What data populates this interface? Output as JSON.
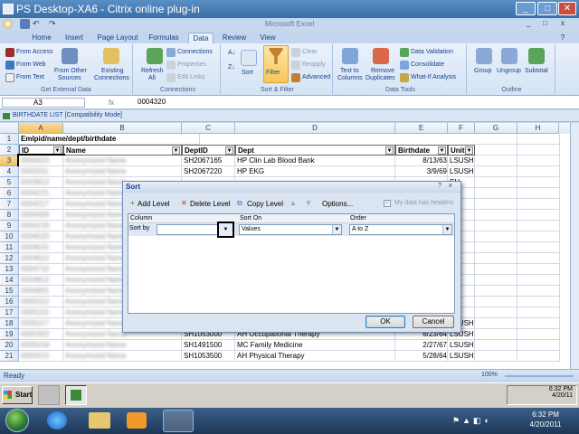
{
  "citrix": {
    "title": "PS Desktop-XA6 - Citrix online plug-in",
    "icon": "citrix-icon"
  },
  "excel": {
    "title": "Microsoft Excel"
  },
  "tabs": [
    "Home",
    "Insert",
    "Page Layout",
    "Formulas",
    "Data",
    "Review",
    "View"
  ],
  "active_tab": "Data",
  "ribbon": {
    "get_external_data": {
      "label": "Get External Data",
      "from_access": "From Access",
      "from_web": "From Web",
      "from_text": "From Text",
      "from_other": "From Other",
      "sources": "Sources",
      "existing": "Existing",
      "connections": "Connections"
    },
    "connections": {
      "label": "Connections",
      "refresh": "Refresh",
      "all": "All",
      "connections": "Connections",
      "properties": "Properties",
      "edit_links": "Edit Links"
    },
    "sort_filter": {
      "label": "Sort & Filter",
      "sort": "Sort",
      "filter": "Filter",
      "clear": "Clear",
      "reapply": "Reapply",
      "advanced": "Advanced"
    },
    "data_tools": {
      "label": "Data Tools",
      "text_to": "Text to",
      "columns": "Columns",
      "remove": "Remove",
      "duplicates": "Duplicates",
      "validation": "Data Validation",
      "consolidate": "Consolidate",
      "what_if": "What-If Analysis"
    },
    "outline": {
      "label": "Outline",
      "group": "Group",
      "ungroup": "Ungroup",
      "subtotal": "Subtotal"
    }
  },
  "formula": {
    "name_box": "A3",
    "fx": "fx",
    "value": "0004320"
  },
  "workbook": {
    "title": "BIRTHDATE LIST  [Compatibility Mode]"
  },
  "columns": [
    "A",
    "B",
    "C",
    "D",
    "E",
    "F",
    "G",
    "H"
  ],
  "rows": [
    {
      "n": "1",
      "a": "Emlpid/name/dept/birthdate",
      "b": "",
      "c": "",
      "d": "",
      "e": "",
      "f": ""
    },
    {
      "n": "2",
      "a": "ID",
      "b": "Name",
      "c": "DeptID",
      "d": "Dept",
      "e": "Birthdate",
      "f": "Unit"
    },
    {
      "n": "3",
      "a": "0004320",
      "b": "Anonymized Name",
      "c": "SH2067165",
      "d": "HP Clin Lab Blood Bank",
      "e": "8/13/63",
      "f": "LSUSH"
    },
    {
      "n": "4",
      "a": "0003311",
      "b": "Anonymized Name",
      "c": "SH2067220",
      "d": "HP EKG",
      "e": "3/9/69",
      "f": "LSUSH"
    },
    {
      "n": "5",
      "a": "0003912",
      "b": "Anonymized Name",
      "c": "",
      "d": "",
      "e": "",
      "f": "SH"
    },
    {
      "n": "6",
      "a": "0004221",
      "b": "Anonymized Name",
      "c": "",
      "d": "",
      "e": "",
      "f": "SH"
    },
    {
      "n": "7",
      "a": "0004217",
      "b": "Anonymized Name",
      "c": "",
      "d": "",
      "e": "",
      "f": "SH"
    },
    {
      "n": "8",
      "a": "0004308",
      "b": "Anonymized Name",
      "c": "",
      "d": "",
      "e": "",
      "f": "SH"
    },
    {
      "n": "9",
      "a": "0004133",
      "b": "Anonymized Name",
      "c": "",
      "d": "",
      "e": "",
      "f": "SH"
    },
    {
      "n": "10",
      "a": "0004520",
      "b": "Anonymized Name",
      "c": "",
      "d": "",
      "e": "",
      "f": "SH"
    },
    {
      "n": "11",
      "a": "0004531",
      "b": "Anonymized Name",
      "c": "",
      "d": "",
      "e": "",
      "f": "SH"
    },
    {
      "n": "12",
      "a": "0004612",
      "b": "Anonymized Name",
      "c": "",
      "d": "",
      "e": "",
      "f": "SH"
    },
    {
      "n": "13",
      "a": "0004710",
      "b": "Anonymized Name",
      "c": "",
      "d": "",
      "e": "",
      "f": "SH"
    },
    {
      "n": "14",
      "a": "0004812",
      "b": "Anonymized Name",
      "c": "",
      "d": "",
      "e": "",
      "f": "SH"
    },
    {
      "n": "15",
      "a": "0004901",
      "b": "Anonymized Name",
      "c": "",
      "d": "",
      "e": "",
      "f": "SH"
    },
    {
      "n": "16",
      "a": "0005012",
      "b": "Anonymized Name",
      "c": "",
      "d": "",
      "e": "",
      "f": "SH"
    },
    {
      "n": "17",
      "a": "0005110",
      "b": "Anonymized Name",
      "c": "",
      "d": "",
      "e": "",
      "f": "SH"
    },
    {
      "n": "18",
      "a": "0005217",
      "b": "Anonymized Name",
      "c": "SH1050100",
      "d": "AH Administration",
      "e": "2/11/54",
      "f": "LSUSH"
    },
    {
      "n": "19",
      "a": "0005302",
      "b": "Anonymized Name",
      "c": "SH1053000",
      "d": "AH Occupational Therapy",
      "e": "6/23/64",
      "f": "LSUSH"
    },
    {
      "n": "20",
      "a": "0005418",
      "b": "Anonymized Name",
      "c": "SH1491500",
      "d": "MC Family Medicine",
      "e": "2/27/67",
      "f": "LSUSH"
    },
    {
      "n": "21",
      "a": "0005510",
      "b": "Anonymized Name",
      "c": "SH1053500",
      "d": "AH Physical Therapy",
      "e": "5/28/64",
      "f": "LSUSH"
    }
  ],
  "status": {
    "ready": "Ready",
    "zoom": "100%"
  },
  "taskbar": {
    "start": "Start",
    "time": "6:32 PM",
    "date": "4/20/11"
  },
  "win7": {
    "time": "6:32 PM",
    "date": "4/20/2011"
  },
  "sort_dialog": {
    "title": "Sort",
    "add_level": "Add Level",
    "delete_level": "Delete Level",
    "copy_level": "Copy Level",
    "options": "Options...",
    "my_data_has_headers": "My data has headers",
    "col_header": "Column",
    "sort_on_header": "Sort On",
    "order_header": "Order",
    "sort_by": "Sort by",
    "column_value": "",
    "sort_on_value": "Values",
    "order_value": "A to Z",
    "ok": "OK",
    "cancel": "Cancel"
  }
}
